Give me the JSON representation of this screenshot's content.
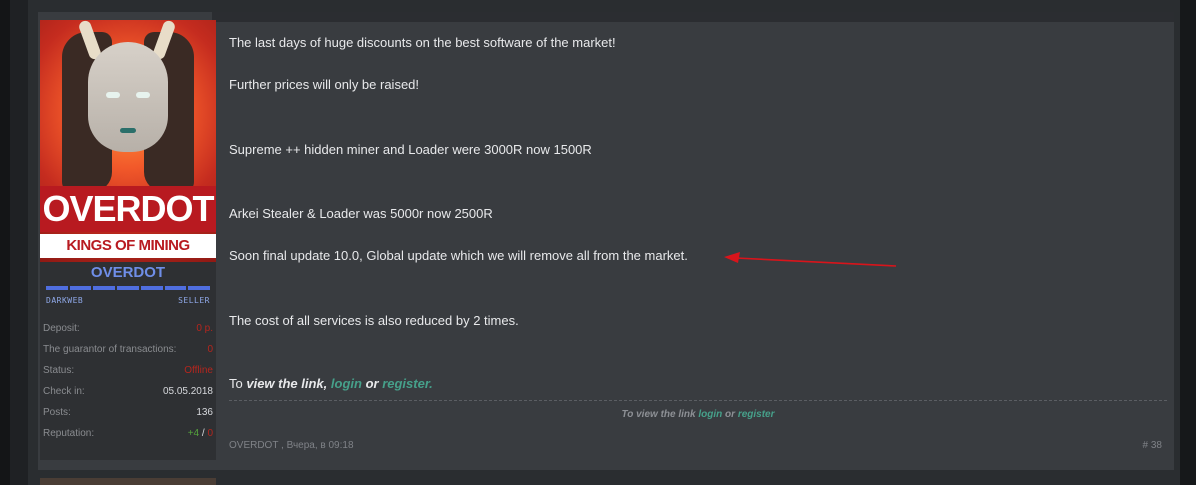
{
  "post": {
    "lines": [
      "The last days of huge discounts on the best software of the market!",
      "Further prices will only be raised!",
      "Supreme ++ hidden miner and Loader were 3000R now 1500R",
      "Arkei Stealer & Loader was 5000r now 2500R",
      "Soon final update 10.0, Global update which we will remove all from the market.",
      "The cost of all services is also reduced by 2 times."
    ],
    "link_prefix": "To",
    "link_bold": "view the link,",
    "login": "login",
    "or": "or",
    "register": "register.",
    "footer_note_prefix": "To view the link",
    "footer_login": "login",
    "footer_or": "or",
    "footer_register": "register",
    "meta": "OVERDOT , Вчера, в 09:18",
    "post_number": "# 38"
  },
  "user": {
    "banner_title": "OVERDOT",
    "banner_subtitle": "KINGS OF MINING",
    "username": "OVERDOT",
    "tag_left": "DARKWEB",
    "tag_right": "SELLER",
    "stats": {
      "deposit_label": "Deposit:",
      "deposit_value": "0 р.",
      "guarantor_label": "The guarantor of transactions:",
      "guarantor_value": "0",
      "status_label": "Status:",
      "status_value": "Offline",
      "checkin_label": "Check in:",
      "checkin_value": "05.05.2018",
      "posts_label": "Posts:",
      "posts_value": "136",
      "reputation_label": "Reputation:",
      "reputation_pos": "+4",
      "reputation_sep": " / ",
      "reputation_neg": "0"
    }
  },
  "colors": {
    "link": "#46a08a",
    "username": "#6f8ee8",
    "banner_red": "#b81a20",
    "annotation_arrow": "#d9141b"
  }
}
